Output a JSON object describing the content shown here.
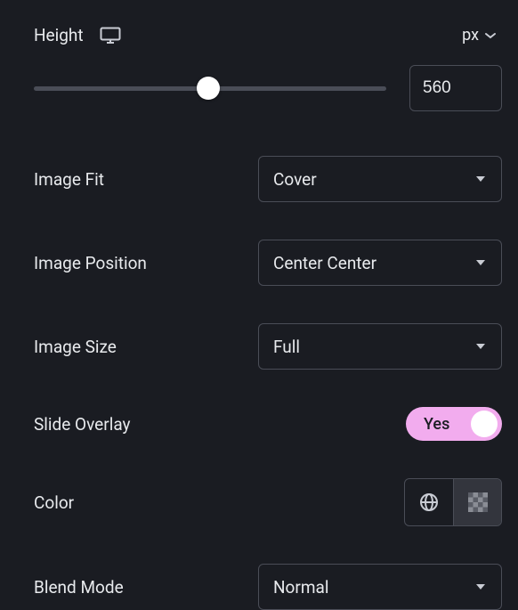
{
  "height": {
    "label": "Height",
    "unit": "px",
    "value": "560",
    "slider_percent": 49.5
  },
  "imageFit": {
    "label": "Image Fit",
    "value": "Cover"
  },
  "imagePosition": {
    "label": "Image Position",
    "value": "Center Center"
  },
  "imageSize": {
    "label": "Image Size",
    "value": "Full"
  },
  "slideOverlay": {
    "label": "Slide Overlay",
    "value": "Yes"
  },
  "color": {
    "label": "Color"
  },
  "blendMode": {
    "label": "Blend Mode",
    "value": "Normal"
  }
}
